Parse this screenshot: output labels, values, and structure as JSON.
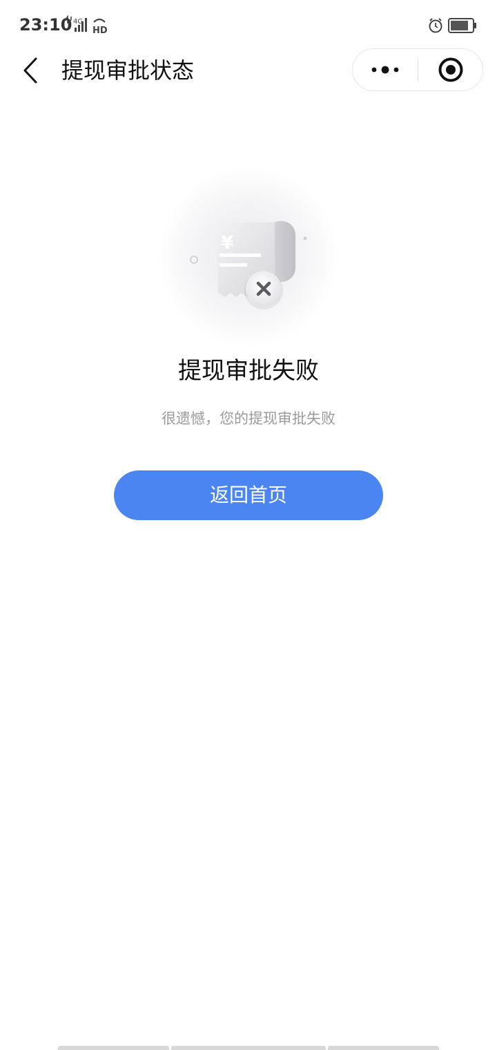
{
  "status_bar": {
    "time": "23:10",
    "network": "4G",
    "hd_badge": "HD"
  },
  "nav": {
    "title": "提现审批状态",
    "back_icon": "chevron-left-icon",
    "more_icon": "more-dots-icon",
    "close_icon": "target-circle-icon"
  },
  "result": {
    "title": "提现审批失败",
    "description": "很遗憾，您的提现审批失败",
    "illustration_symbol": "¥"
  },
  "actions": {
    "home_label": "返回首页"
  },
  "colors": {
    "primary": "#4a85f2",
    "title_text": "#111111",
    "secondary_text": "#9a9a9a"
  }
}
